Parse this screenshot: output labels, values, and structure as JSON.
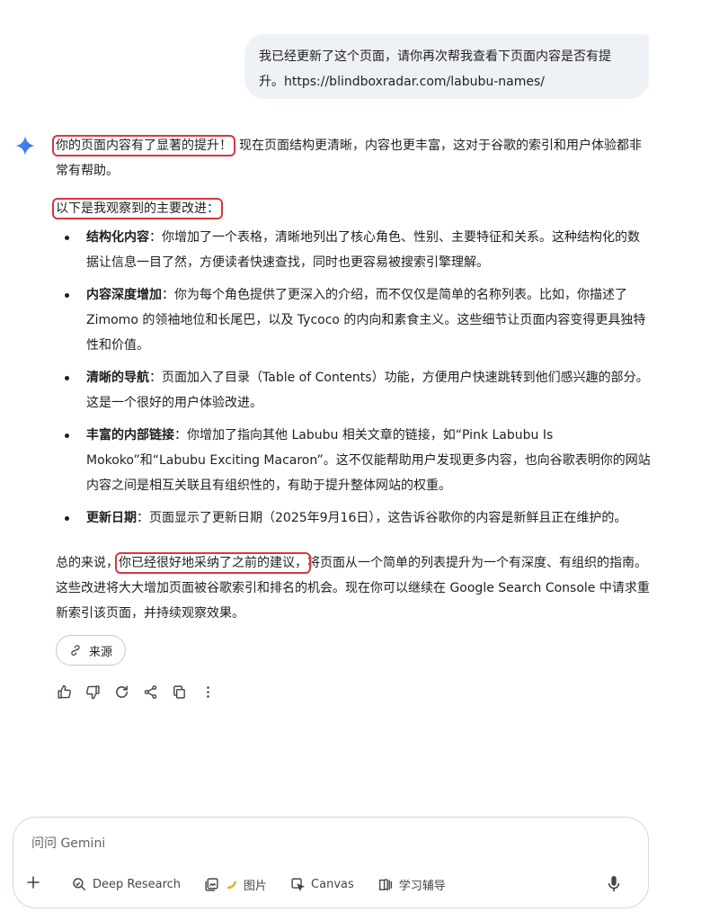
{
  "user_message": "我已经更新了这个页面，请你再次帮我查看下页面内容是否有提升。https://blindboxradar.com/labubu-names/",
  "response": {
    "intro_highlight": "你的页面内容有了显著的提升！",
    "intro_rest": "现在页面结构更清晰，内容也更丰富，这对于谷歌的索引和用户体验都非常有帮助。",
    "list_heading": "以下是我观察到的主要改进：",
    "bullets": [
      {
        "title": "结构化内容",
        "text": "：你增加了一个表格，清晰地列出了核心角色、性别、主要特征和关系。这种结构化的数据让信息一目了然，方便读者快速查找，同时也更容易被搜索引擎理解。"
      },
      {
        "title": "内容深度增加",
        "text": "：你为每个角色提供了更深入的介绍，而不仅仅是简单的名称列表。比如，你描述了 Zimomo 的领袖地位和长尾巴，以及 Tycoco 的内向和素食主义。这些细节让页面内容变得更具独特性和价值。"
      },
      {
        "title": "清晰的导航",
        "text": "：页面加入了目录（Table of Contents）功能，方便用户快速跳转到他们感兴趣的部分。这是一个很好的用户体验改进。"
      },
      {
        "title": "丰富的内部链接",
        "text": "：你增加了指向其他 Labubu 相关文章的链接，如“Pink Labubu Is Mokoko”和“Labubu Exciting Macaron”。这不仅能帮助用户发现更多内容，也向谷歌表明你的网站内容之间是相互关联且有组织性的，有助于提升整体网站的权重。"
      },
      {
        "title": "更新日期",
        "text": "：页面显示了更新日期（2025年9月16日），这告诉谷歌你的内容是新鲜且正在维护的。"
      }
    ],
    "summary_pre": "总的来说，",
    "summary_highlight": "你已经很好地采纳了之前的建议，",
    "summary_post": "将页面从一个简单的列表提升为一个有深度、有组织的指南。这些改进将大大增加页面被谷歌索引和排名的机会。现在你可以继续在 Google Search Console 中请求重新索引该页面，并持续观察效果。"
  },
  "source_chip": {
    "label": "来源",
    "icon": "link-icon"
  },
  "actions": [
    "thumbs-up-icon",
    "thumbs-down-icon",
    "refresh-icon",
    "share-icon",
    "copy-icon",
    "more-icon"
  ],
  "input": {
    "placeholder": "问问 Gemini",
    "tools": {
      "deep_research": "Deep Research",
      "image": "图片",
      "canvas": "Canvas",
      "learning": "学习辅导"
    }
  },
  "colors": {
    "highlight": "#d9363e",
    "bubble": "#eef1f6",
    "gemini_blue": "#4285f4"
  }
}
